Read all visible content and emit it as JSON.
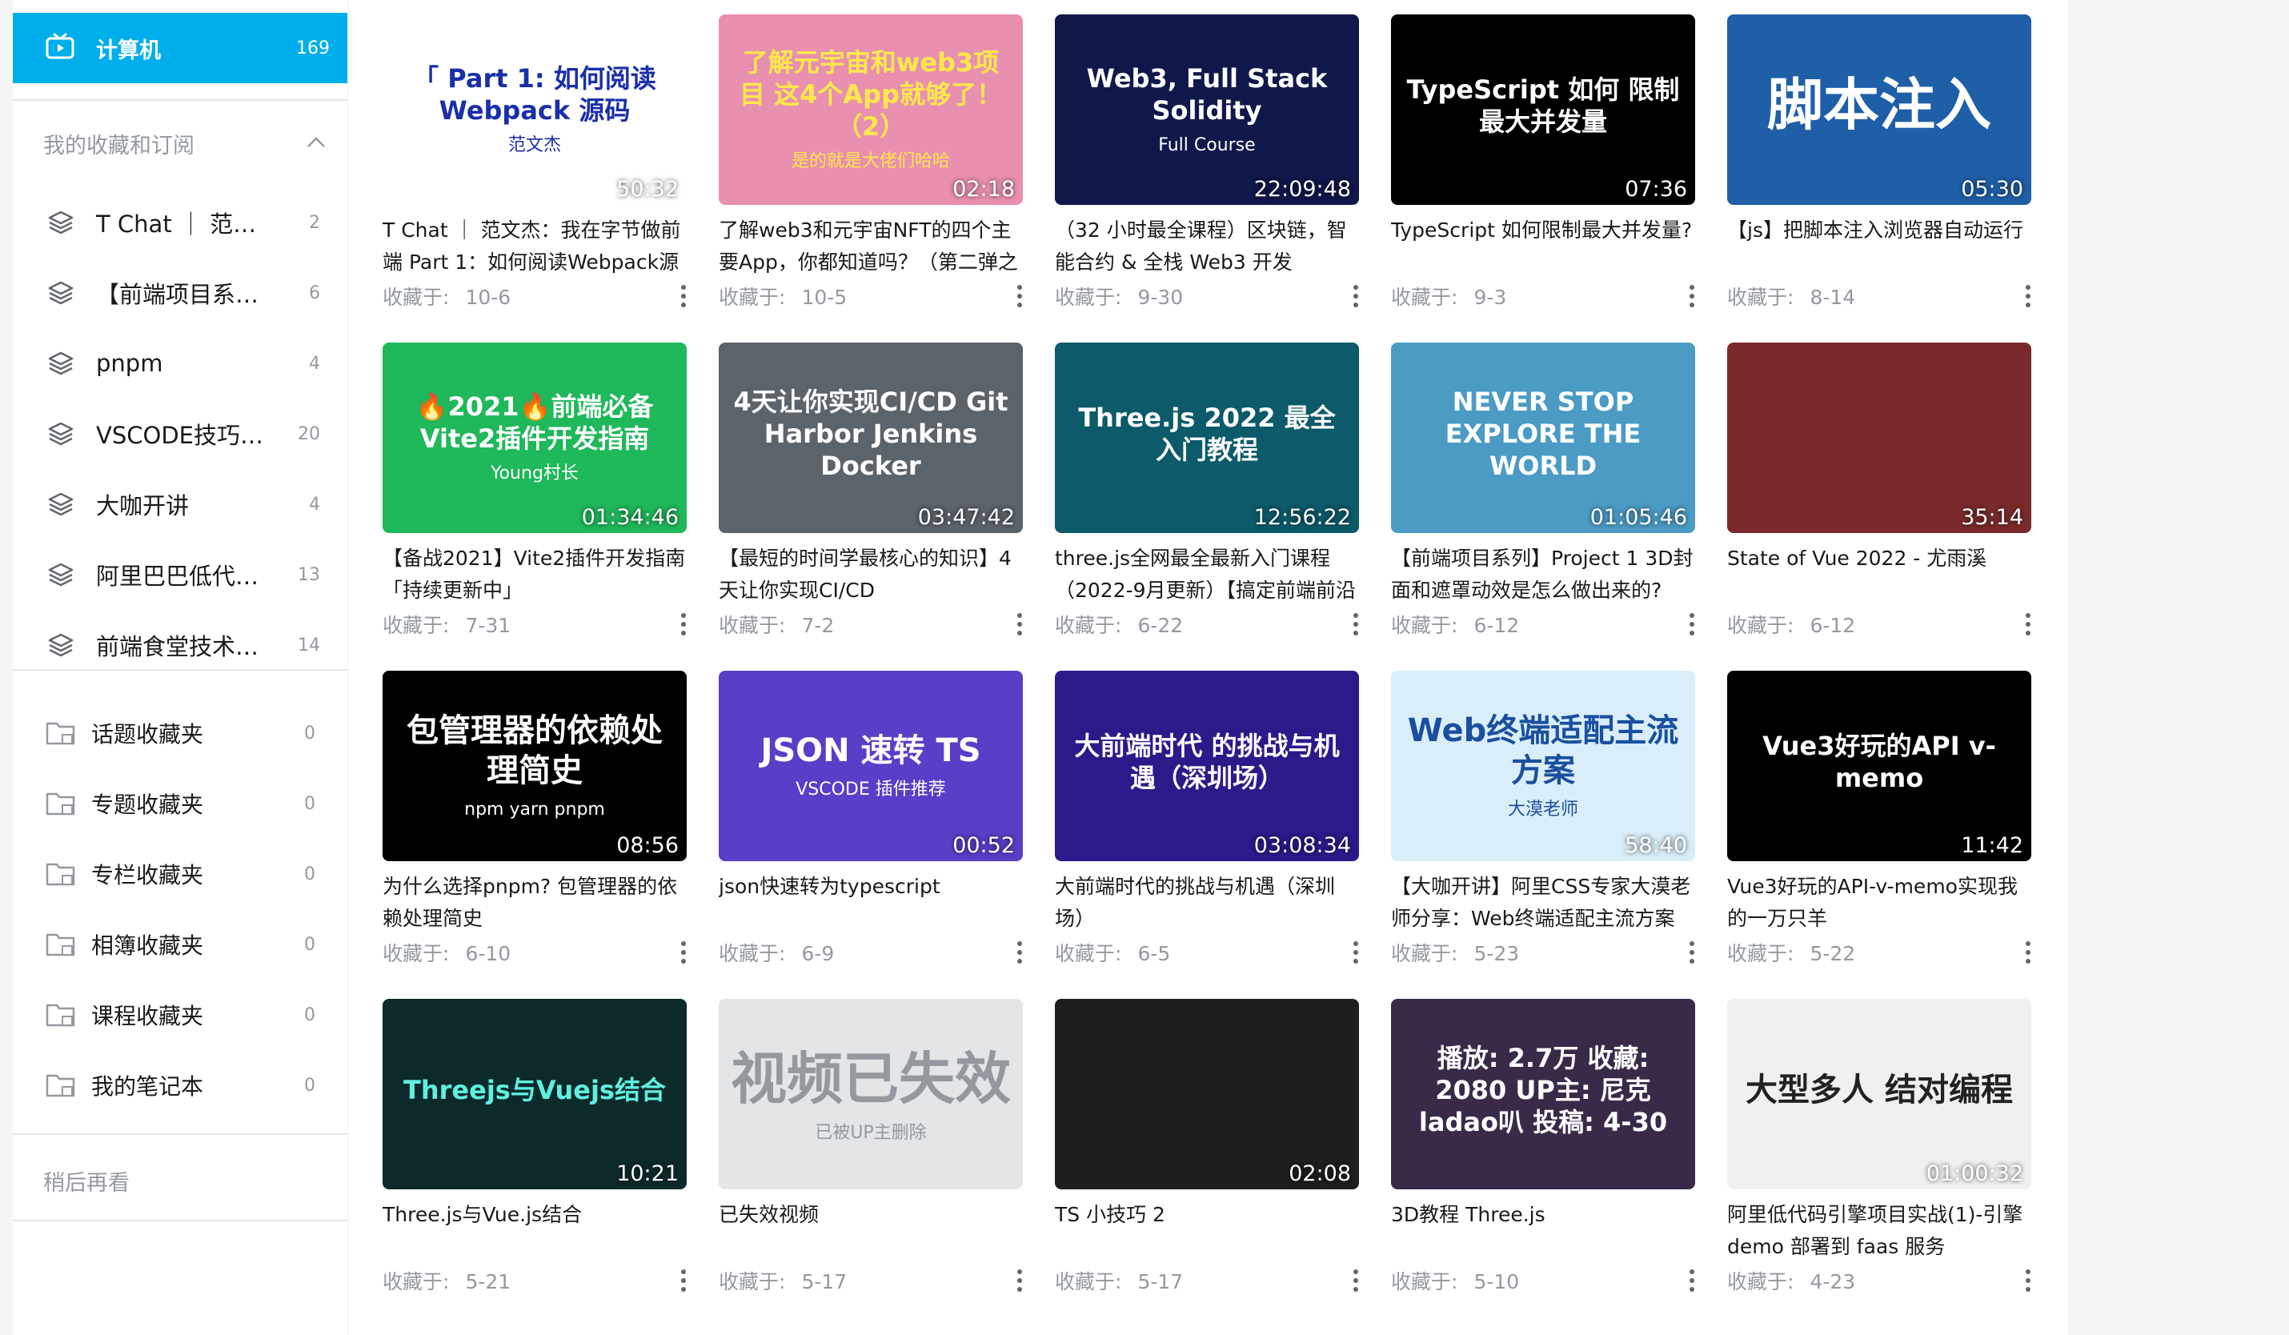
{
  "sidebar": {
    "active": {
      "label": "计算机",
      "count": "169",
      "icon": "tv-icon"
    },
    "favorites_title": "我的收藏和订阅",
    "subscriptions": [
      {
        "label": "T Chat ｜ 范…",
        "count": "2"
      },
      {
        "label": "【前端项目系…",
        "count": "6"
      },
      {
        "label": "pnpm",
        "count": "4"
      },
      {
        "label": "VSCODE技巧…",
        "count": "20"
      },
      {
        "label": "大咖开讲",
        "count": "4"
      },
      {
        "label": "阿里巴巴低代…",
        "count": "13"
      },
      {
        "label": "前端食堂技术…",
        "count": "14"
      }
    ],
    "folders": [
      {
        "label": "话题收藏夹",
        "count": "0"
      },
      {
        "label": "专题收藏夹",
        "count": "0"
      },
      {
        "label": "专栏收藏夹",
        "count": "0"
      },
      {
        "label": "相簿收藏夹",
        "count": "0"
      },
      {
        "label": "课程收藏夹",
        "count": "0"
      },
      {
        "label": "我的笔记本",
        "count": "0"
      }
    ],
    "watch_later": "稍后再看"
  },
  "meta_prefix": "收藏于:",
  "videos": [
    {
      "thumb_text": "「 Part 1: 如何阅读 Webpack 源码",
      "thumb_sub": "范文杰",
      "duration": "50:32",
      "title": "T Chat ｜ 范文杰：我在字节做前端 Part 1：如何阅读Webpack源",
      "date": "10-6",
      "bg": "#ffffff",
      "fg": "#1a2fa8"
    },
    {
      "thumb_text": "了解元宇宙和web3项目 这4个App就够了！（2）",
      "thumb_sub": "是的就是大佬们哈哈",
      "duration": "02:18",
      "title": "了解web3和元宇宙NFT的四个主要App，你都知道吗？（第二弹之",
      "date": "10-5",
      "bg": "#e98fb0",
      "fg": "#ffe94a"
    },
    {
      "thumb_text": "Web3, Full Stack Solidity",
      "thumb_sub": "Full Course",
      "duration": "22:09:48",
      "title": "（32 小时最全课程）区块链，智能合约 & 全栈 Web3 开发",
      "date": "9-30",
      "bg": "#10174a",
      "fg": "#ffffff"
    },
    {
      "thumb_text": "TypeScript 如何 限制最大并发量",
      "thumb_sub": "",
      "duration": "07:36",
      "title": "TypeScript 如何限制最大并发量?",
      "date": "9-3",
      "bg": "#000000",
      "fg": "#ffffff"
    },
    {
      "thumb_text": "脚本注入",
      "thumb_sub": "",
      "duration": "05:30",
      "title": "【js】把脚本注入浏览器自动运行",
      "date": "8-14",
      "bg": "#1f5fa8",
      "fg": "#ffffff"
    },
    {
      "thumb_text": "🔥2021🔥前端必备 Vite2插件开发指南",
      "thumb_sub": "Young村长",
      "duration": "01:34:46",
      "title": "【备战2021】Vite2插件开发指南「持续更新中」",
      "date": "7-31",
      "bg": "#1fb85a",
      "fg": "#ffffff"
    },
    {
      "thumb_text": "4天让你实现CI/CD Git Harbor Jenkins Docker",
      "thumb_sub": "",
      "duration": "03:47:42",
      "title": "【最短的时间学最核心的知识】4天让你实现CI/CD",
      "date": "7-2",
      "bg": "#5b636b",
      "fg": "#ffffff"
    },
    {
      "thumb_text": "Three.js 2022 最全入门教程",
      "thumb_sub": "",
      "duration": "12:56:22",
      "title": "three.js全网最全最新入门课程（2022-9月更新）【搞定前端前沿",
      "date": "6-22",
      "bg": "#0c5a6a",
      "fg": "#ffffff"
    },
    {
      "thumb_text": "NEVER STOP EXPLORE THE WORLD",
      "thumb_sub": "",
      "duration": "01:05:46",
      "title": "【前端项目系列】Project 1 3D封面和遮罩动效是怎么做出来的?",
      "date": "6-12",
      "bg": "#4b9bc4",
      "fg": "#ffffff"
    },
    {
      "thumb_text": "",
      "thumb_sub": "",
      "duration": "35:14",
      "title": "State of Vue 2022 - 尤雨溪",
      "date": "6-12",
      "bg": "#7a2a2a",
      "fg": "#ffffff"
    },
    {
      "thumb_text": "包管理器的依赖处理简史",
      "thumb_sub": "npm  yarn  pnpm",
      "duration": "08:56",
      "title": "为什么选择pnpm? 包管理器的依赖处理简史",
      "date": "6-10",
      "bg": "#000000",
      "fg": "#ffffff"
    },
    {
      "thumb_text": "JSON 速转 TS",
      "thumb_sub": "VSCODE 插件推荐",
      "duration": "00:52",
      "title": "json快速转为typescript",
      "date": "6-9",
      "bg": "#5a3ec8",
      "fg": "#ffffff"
    },
    {
      "thumb_text": "大前端时代 的挑战与机遇（深圳场）",
      "thumb_sub": "",
      "duration": "03:08:34",
      "title": "大前端时代的挑战与机遇（深圳场）",
      "date": "6-5",
      "bg": "#2a1a8a",
      "fg": "#ffffff"
    },
    {
      "thumb_text": "Web终端适配主流方案",
      "thumb_sub": "大漠老师",
      "duration": "58:40",
      "title": "【大咖开讲】阿里CSS专家大漠老师分享：Web终端适配主流方案",
      "date": "5-23",
      "bg": "#d9eef8",
      "fg": "#1a4fa0"
    },
    {
      "thumb_text": "Vue3好玩的API v-memo",
      "thumb_sub": "",
      "duration": "11:42",
      "title": "Vue3好玩的API-v-memo实现我的一万只羊",
      "date": "5-22",
      "bg": "#000000",
      "fg": "#ffffff"
    },
    {
      "thumb_text": "Threejs与Vuejs结合",
      "thumb_sub": "",
      "duration": "10:21",
      "title": "Three.js与Vue.js结合",
      "date": "5-21",
      "bg": "#0d2a2a",
      "fg": "#5ff0e0"
    },
    {
      "thumb_text": "视频已失效",
      "thumb_sub": "已被UP主删除",
      "duration": "",
      "title": "已失效视频",
      "date": "5-17",
      "bg": "#e3e5e7",
      "fg": "#9499a0"
    },
    {
      "thumb_text": "",
      "thumb_sub": "",
      "duration": "02:08",
      "title": "TS 小技巧 2",
      "date": "5-17",
      "bg": "#1e1e1e",
      "fg": "#ffffff"
    },
    {
      "thumb_text": "播放: 2.7万 收藏: 2080 UP主: 尼克ladao叭 投稿: 4-30",
      "thumb_sub": "",
      "duration": "",
      "title": "3D教程 Three.js",
      "date": "5-10",
      "bg": "#3a2a4a",
      "fg": "#ffffff"
    },
    {
      "thumb_text": "大型多人 结对编程",
      "thumb_sub": "",
      "duration": "01:00:32",
      "title": "阿里低代码引擎项目实战(1)-引擎demo 部署到 faas 服务",
      "date": "4-23",
      "bg": "#f0f0f0",
      "fg": "#222222"
    }
  ]
}
